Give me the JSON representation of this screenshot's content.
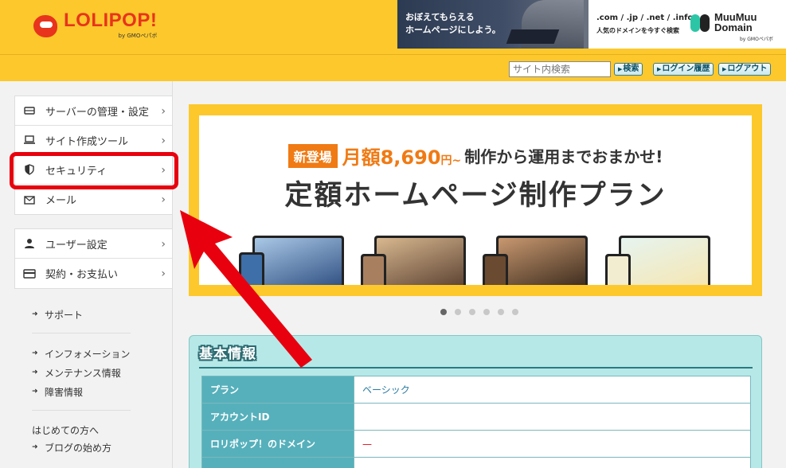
{
  "header": {
    "logo_text": "LOLIPOP!",
    "logo_by": "by GMOペパボ",
    "banner_left_line1": "おぼえてもらえる",
    "banner_left_line2": "ホームページにしよう。",
    "banner_right_domains": ".com / .jp / .net / .info",
    "banner_right_tagline": "人気のドメインを今すぐ検索",
    "banner_brand_line1": "MuuMuu",
    "banner_brand_line2": "Domain",
    "banner_brand_by": "by GMOペパボ"
  },
  "toolbar": {
    "search_placeholder": "サイト内検索",
    "search_button": "検索",
    "login_history_button": "ログイン履歴",
    "logout_button": "ログアウト"
  },
  "sidebar": {
    "group1": [
      {
        "label": "サーバーの管理・設定",
        "icon": "server-icon"
      },
      {
        "label": "サイト作成ツール",
        "icon": "laptop-icon"
      },
      {
        "label": "セキュリティ",
        "icon": "shield-icon"
      },
      {
        "label": "メール",
        "icon": "mail-icon"
      }
    ],
    "group2": [
      {
        "label": "ユーザー設定",
        "icon": "user-icon"
      },
      {
        "label": "契約・お支払い",
        "icon": "credit-card-icon"
      }
    ],
    "links1": [
      "サポート"
    ],
    "links2": [
      "インフォメーション",
      "メンテナンス情報",
      "障害情報"
    ],
    "beginner_label": "はじめての方へ",
    "links3": [
      "ブログの始め方"
    ]
  },
  "hero": {
    "badge": "新登場",
    "price_prefix": "月額",
    "price": "8,690",
    "price_suffix": "円~",
    "line1_rest": "制作から運用までおまかせ!",
    "line2": "定額ホームページ制作プラン"
  },
  "carousel": {
    "count": 6,
    "active_index": 0
  },
  "info": {
    "title": "基本情報",
    "rows": [
      {
        "key": "プラン",
        "value": "ベーシック"
      },
      {
        "key": "アカウントID",
        "value": ""
      },
      {
        "key": "ロリポップ！のドメイン",
        "value": "—"
      }
    ]
  },
  "colors": {
    "brand_yellow": "#fcc82c",
    "highlight_red": "#e8000e",
    "accent_orange": "#f07a14",
    "info_teal": "#56b0bb"
  }
}
